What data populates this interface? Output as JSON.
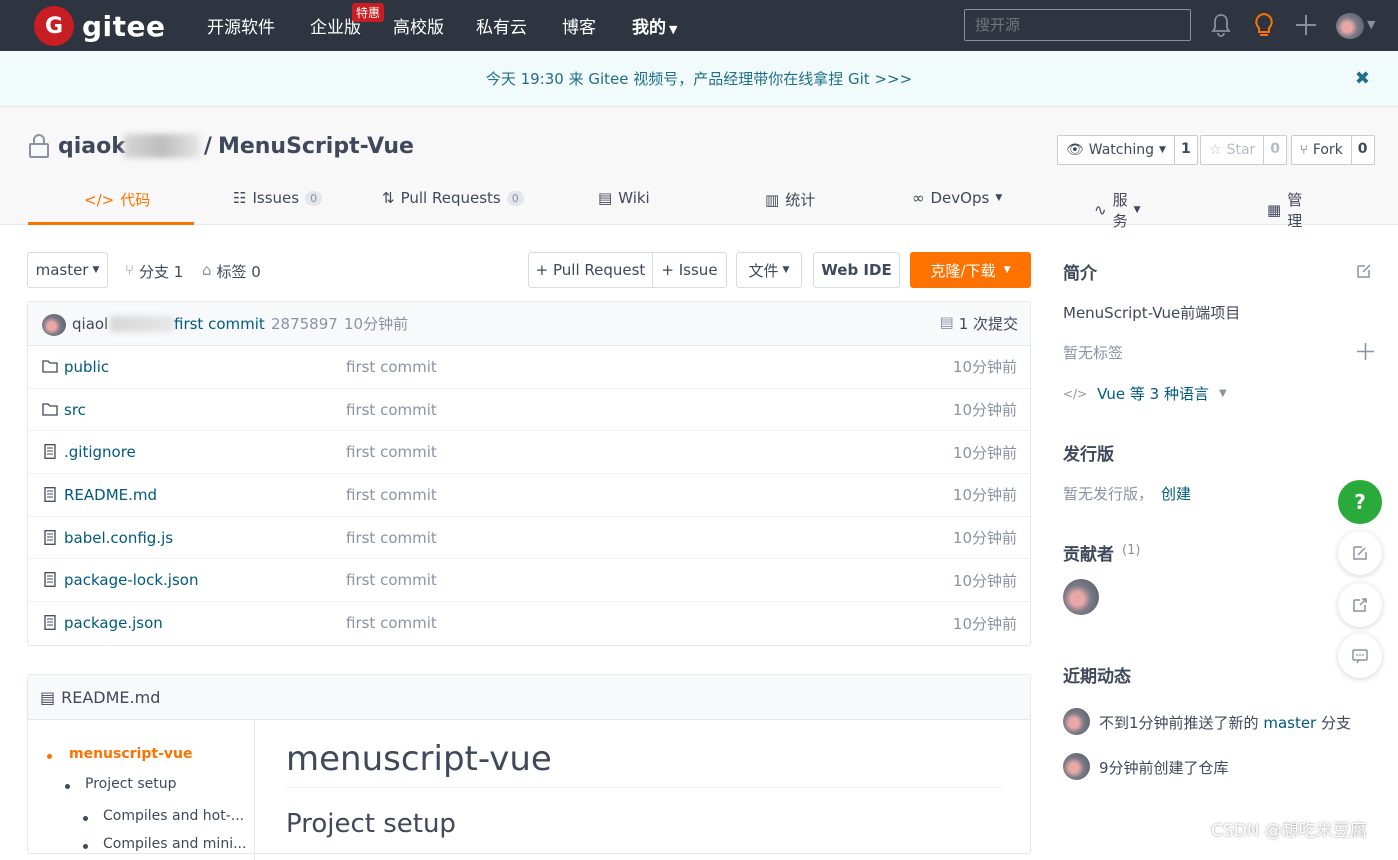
{
  "nav": {
    "logo_text": "gitee",
    "logo_letter": "G",
    "items": [
      "开源软件",
      "企业版",
      "高校版",
      "私有云",
      "博客",
      "我的"
    ],
    "hot_badge": "特惠",
    "search_placeholder": "搜开源"
  },
  "banner": {
    "text": "今天 19:30 来 Gitee 视频号，产品经理带你在线拿捏 Git >>>",
    "close": "✖"
  },
  "repo": {
    "owner": "qiaok",
    "separator": "/",
    "name": "MenuScript-Vue",
    "watch_label": "Watching",
    "watch_count": "1",
    "star_label": "Star",
    "star_count": "0",
    "fork_label": "Fork",
    "fork_count": "0"
  },
  "tabs": {
    "code": "代码",
    "issues": "Issues",
    "issues_count": "0",
    "pulls": "Pull Requests",
    "pulls_count": "0",
    "wiki": "Wiki",
    "stats": "统计",
    "devops": "DevOps",
    "service": "服务",
    "manage": "管理"
  },
  "toolbar": {
    "branch": "master",
    "branches": "分支 1",
    "tags": "标签 0",
    "pull_request": "+ Pull Request",
    "issue": "+ Issue",
    "file": "文件",
    "webide": "Web IDE",
    "clone": "克隆/下载"
  },
  "commit": {
    "author": "qiaol",
    "message": "first commit",
    "hash": "2875897",
    "time": "10分钟前",
    "count": "1 次提交"
  },
  "files": [
    {
      "name": "public",
      "type": "folder",
      "message": "first commit",
      "time": "10分钟前"
    },
    {
      "name": "src",
      "type": "folder",
      "message": "first commit",
      "time": "10分钟前"
    },
    {
      "name": ".gitignore",
      "type": "file",
      "message": "first commit",
      "time": "10分钟前"
    },
    {
      "name": "README.md",
      "type": "file",
      "message": "first commit",
      "time": "10分钟前"
    },
    {
      "name": "babel.config.js",
      "type": "file",
      "message": "first commit",
      "time": "10分钟前"
    },
    {
      "name": "package-lock.json",
      "type": "file",
      "message": "first commit",
      "time": "10分钟前"
    },
    {
      "name": "package.json",
      "type": "file",
      "message": "first commit",
      "time": "10分钟前"
    }
  ],
  "readme": {
    "title": "README.md",
    "toc": [
      "menuscript-vue",
      "Project setup",
      "Compiles and hot-...",
      "Compiles and mini..."
    ],
    "h1": "menuscript-vue",
    "h2": "Project setup"
  },
  "sidebar": {
    "intro_title": "简介",
    "description": "MenuScript-Vue前端项目",
    "no_tags": "暂无标签",
    "languages": "Vue 等 3 种语言",
    "release_title": "发行版",
    "no_release": "暂无发行版，",
    "create": "创建",
    "contributors_title": "贡献者",
    "contributors_count": "(1)",
    "activity_title": "近期动态",
    "activity": [
      {
        "prefix": "不到1分钟前推送了新的 ",
        "branch": "master",
        "suffix": " 分支"
      },
      {
        "prefix": "9分钟前创建了仓库",
        "branch": "",
        "suffix": ""
      }
    ]
  },
  "watermark": "CSDN @想吃米豆腐",
  "colors": {
    "nav_bg": "#2e3440",
    "accent": "#fe7300",
    "brand_red": "#c71d23",
    "link": "#005980",
    "help_green": "#2aaa3a"
  }
}
